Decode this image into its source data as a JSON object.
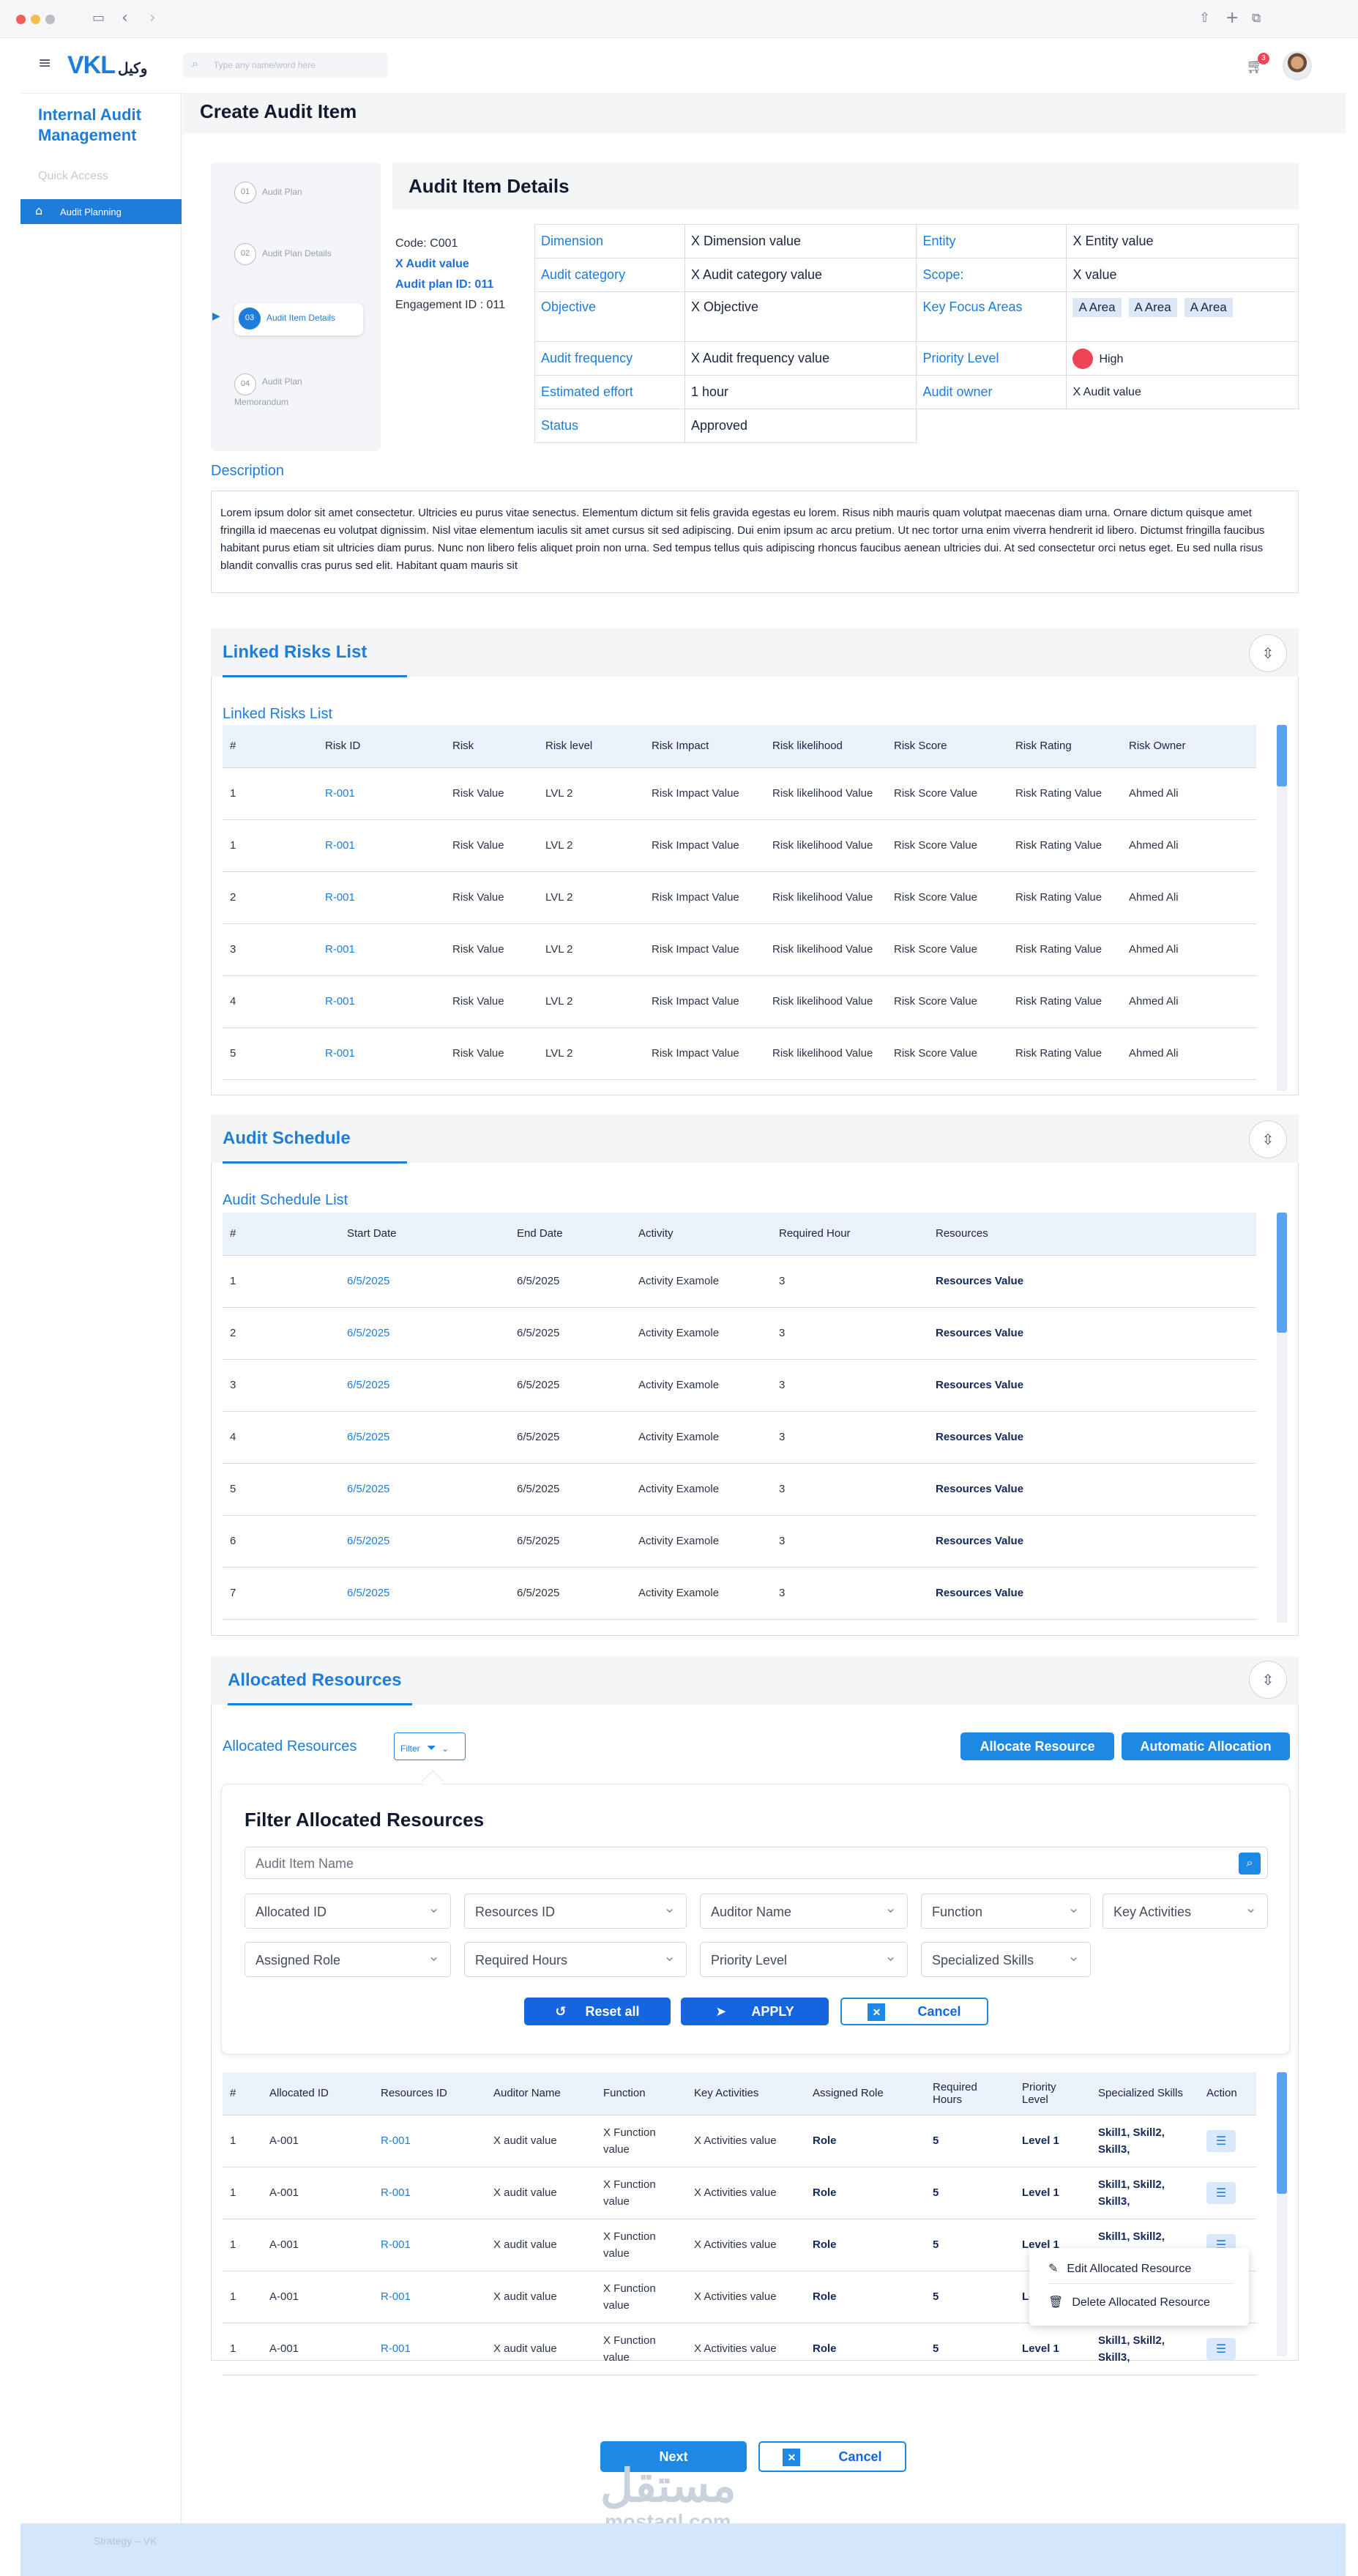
{
  "app": {
    "logo_latin": "VKL",
    "logo_arabic": "وكيل",
    "search_placeholder": "Type any name/word here",
    "notifications": "3"
  },
  "sidebar": {
    "title": "Internal Audit Management",
    "quick_access": "Quick Access",
    "active_item": "Audit Planning",
    "footer_text": "Strategy – VK"
  },
  "page": {
    "title": "Create Audit Item"
  },
  "stepper": [
    {
      "num": "01",
      "label": "Audit Plan"
    },
    {
      "num": "02",
      "label": "Audit Plan Details"
    },
    {
      "num": "03",
      "label": "Audit Item Details"
    },
    {
      "num": "04",
      "label": "Audit Plan Memorandum"
    }
  ],
  "details": {
    "title": "Audit Item Details",
    "code": "Code: C001",
    "audit_value": "X Audit value",
    "plan_id": "Audit plan ID: 011",
    "engagement": "Engagement ID : 011",
    "fields": {
      "dimension": {
        "label": "Dimension",
        "value": "X Dimension value"
      },
      "entity": {
        "label": "Entity",
        "value": "X Entity value"
      },
      "audit_category": {
        "label": "Audit category",
        "value": "X Audit category value"
      },
      "scope": {
        "label": "Scope:",
        "value": "X value"
      },
      "objective": {
        "label": "Objective",
        "value": "X Objective"
      },
      "key_focus": {
        "label": "Key Focus Areas",
        "values": [
          "A Area",
          "A Area",
          "A Area"
        ]
      },
      "audit_frequency": {
        "label": "Audit frequency",
        "value": "X Audit frequency value"
      },
      "priority": {
        "label": "Priority Level",
        "value": "High",
        "color": "#ef4456"
      },
      "effort": {
        "label": "Estimated effort",
        "value": "1 hour"
      },
      "owner": {
        "label": "Audit owner",
        "value": "X Audit value"
      },
      "status": {
        "label": "Status",
        "value": "Approved"
      }
    },
    "description_label": "Description",
    "description": "Lorem ipsum dolor sit amet consectetur. Ultricies eu purus vitae senectus. Elementum dictum sit felis gravida egestas eu lorem. Risus nibh mauris quam volutpat maecenas diam urna. Ornare dictum quisque amet fringilla id maecenas eu volutpat dignissim. Nisl vitae elementum iaculis sit amet cursus sit sed adipiscing. Dui enim ipsum ac arcu pretium. Ut nec tortor urna enim viverra hendrerit id libero. Dictumst fringilla faucibus habitant purus etiam sit ultricies diam purus. Nunc non libero felis aliquet proin non urna. Sed tempus tellus quis adipiscing rhoncus faucibus aenean ultricies dui. At sed consectetur orci netus eget. Eu sed nulla risus blandit convallis cras purus sed elit. Habitant quam mauris sit"
  },
  "risks": {
    "title": "Linked Risks List",
    "list_title": "Linked Risks List",
    "headers": [
      "#",
      "Risk ID",
      "Risk",
      "Risk  level",
      "Risk Impact",
      "Risk likelihood",
      "Risk  Score",
      "Risk  Rating",
      "Risk Owner"
    ],
    "rows": [
      [
        "1",
        "R-001",
        "Risk Value",
        "LVL 2",
        "Risk  Impact Value",
        "Risk  likelihood Value",
        "Risk  Score Value",
        "Risk  Rating Value",
        "Ahmed Ali"
      ],
      [
        "1",
        "R-001",
        "Risk Value",
        "LVL 2",
        "Risk  Impact Value",
        "Risk  likelihood Value",
        "Risk  Score Value",
        "Risk  Rating Value",
        "Ahmed Ali"
      ],
      [
        "2",
        "R-001",
        "Risk Value",
        "LVL 2",
        "Risk  Impact Value",
        "Risk  likelihood Value",
        "Risk  Score Value",
        "Risk  Rating Value",
        "Ahmed Ali"
      ],
      [
        "3",
        "R-001",
        "Risk Value",
        "LVL 2",
        "Risk  Impact Value",
        "Risk  likelihood Value",
        "Risk  Score Value",
        "Risk  Rating Value",
        "Ahmed Ali"
      ],
      [
        "4",
        "R-001",
        "Risk Value",
        "LVL 2",
        "Risk  Impact Value",
        "Risk  likelihood Value",
        "Risk  Score Value",
        "Risk  Rating Value",
        "Ahmed Ali"
      ],
      [
        "5",
        "R-001",
        "Risk Value",
        "LVL 2",
        "Risk  Impact Value",
        "Risk  likelihood Value",
        "Risk  Score Value",
        "Risk  Rating Value",
        "Ahmed Ali"
      ]
    ]
  },
  "schedule": {
    "title": "Audit Schedule",
    "list_title": "Audit Schedule List",
    "headers": [
      "#",
      "Start Date",
      "End Date",
      "Activity",
      "Required Hour",
      "Resources"
    ],
    "rows": [
      [
        "1",
        "6/5/2025",
        "6/5/2025",
        "Activity Examole",
        "3",
        "Resources Value"
      ],
      [
        "2",
        "6/5/2025",
        "6/5/2025",
        "Activity Examole",
        "3",
        "Resources Value"
      ],
      [
        "3",
        "6/5/2025",
        "6/5/2025",
        "Activity Examole",
        "3",
        "Resources Value"
      ],
      [
        "4",
        "6/5/2025",
        "6/5/2025",
        "Activity Examole",
        "3",
        "Resources Value"
      ],
      [
        "5",
        "6/5/2025",
        "6/5/2025",
        "Activity Examole",
        "3",
        "Resources Value"
      ],
      [
        "6",
        "6/5/2025",
        "6/5/2025",
        "Activity Examole",
        "3",
        "Resources Value"
      ],
      [
        "7",
        "6/5/2025",
        "6/5/2025",
        "Activity Examole",
        "3",
        "Resources Value"
      ]
    ]
  },
  "resources": {
    "title": "Allocated Resources",
    "list_title": "Allocated Resources",
    "filter_button": "Filter",
    "allocate_button": "Allocate Resource",
    "auto_button": "Automatic Allocation",
    "filter": {
      "title": "Filter Allocated Resources",
      "name_placeholder": "Audit Item Name",
      "selects_row1": [
        "Allocated ID",
        "Resources ID",
        "Auditor Name",
        "Function",
        "Key Activities"
      ],
      "selects_row2": [
        "Assigned Role",
        "Required Hours",
        "Priority Level",
        "Specialized Skills"
      ],
      "reset": "Reset all",
      "apply": "APPLY",
      "cancel": "Cancel"
    },
    "headers": [
      "#",
      "Allocated ID",
      "Resources ID",
      "Auditor Name",
      "Function",
      "Key Activities",
      "Assigned Role",
      "Required Hours",
      "Priority Level",
      "Specialized Skills",
      "Action"
    ],
    "rows": [
      [
        "1",
        "A-001",
        "R-001",
        "X audit value",
        "X Function value",
        "X Activities value",
        "Role",
        "5",
        "Level 1",
        "Skill1, Skill2, Skill3,"
      ],
      [
        "1",
        "A-001",
        "R-001",
        "X audit value",
        "X Function value",
        "X Activities value",
        "Role",
        "5",
        "Level 1",
        "Skill1, Skill2, Skill3,"
      ],
      [
        "1",
        "A-001",
        "R-001",
        "X audit value",
        "X Function value",
        "X Activities value",
        "Role",
        "5",
        "Level 1",
        "Skill1, Skill2, Skill3,"
      ],
      [
        "1",
        "A-001",
        "R-001",
        "X audit value",
        "X Function value",
        "X Activities value",
        "Role",
        "5",
        "Level 1",
        "Skill1, Skill2, Skill3,"
      ],
      [
        "1",
        "A-001",
        "R-001",
        "X audit value",
        "X Function value",
        "X Activities value",
        "Role",
        "5",
        "Level 1",
        "Skill1, Skill2, Skill3,"
      ]
    ],
    "menu": {
      "edit": "Edit Allocated Resource",
      "delete": "Delete Allocated Resource"
    }
  },
  "footer_actions": {
    "next": "Next",
    "cancel": "Cancel"
  },
  "watermark": {
    "arabic": "مستقل",
    "latin": "mostaql.com"
  }
}
